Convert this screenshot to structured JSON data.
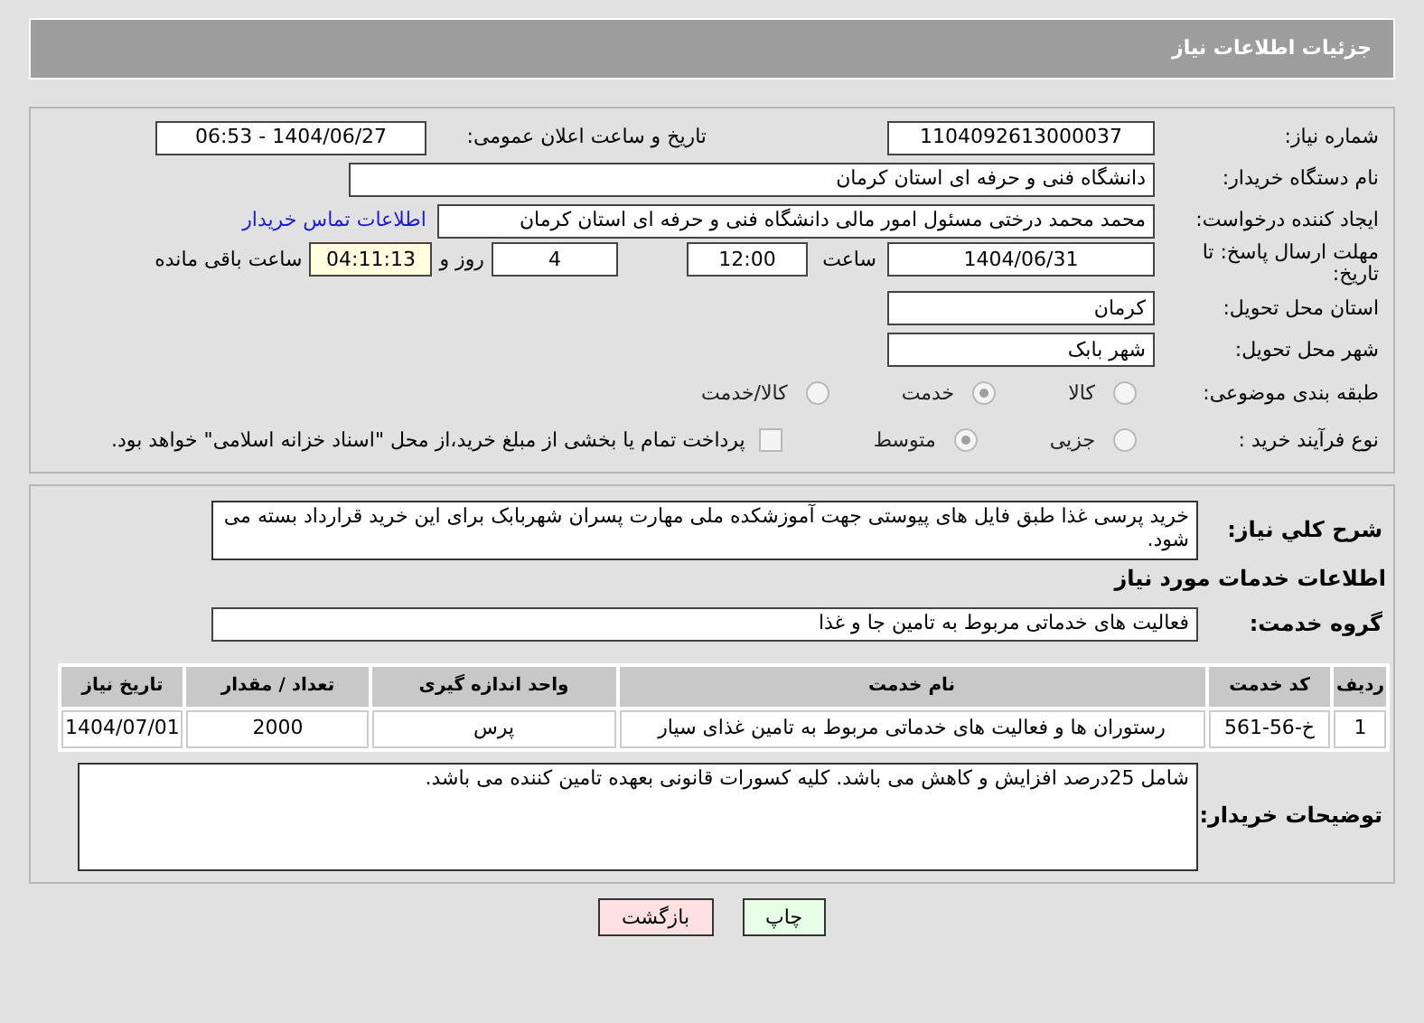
{
  "header": {
    "title": "جزئیات اطلاعات نیاز"
  },
  "details": {
    "need_number": {
      "label": "شماره نیاز:",
      "value": "1104092613000037"
    },
    "announce": {
      "label": "تاریخ و ساعت اعلان عمومی:",
      "value": "1404/06/27 - 06:53"
    },
    "buyer": {
      "label": "نام دستگاه خریدار:",
      "value": "دانشگاه فنی و حرفه ای استان کرمان"
    },
    "requester": {
      "label": "ایجاد کننده درخواست:",
      "value": "محمد محمد درختی مسئول امور مالی دانشگاه فنی و حرفه ای استان کرمان",
      "link": "اطلاعات تماس خریدار"
    },
    "deadline": {
      "label": "مهلت ارسال پاسخ: تا تاریخ:",
      "date": "1404/06/31",
      "time_label": "ساعت",
      "time": "12:00",
      "days": "4",
      "days_label": "روز و",
      "remaining": "04:11:13",
      "remaining_label": "ساعت باقی مانده"
    },
    "province": {
      "label": "استان محل تحویل:",
      "value": "کرمان"
    },
    "city": {
      "label": "شهر محل تحویل:",
      "value": "شهر بابک"
    },
    "category": {
      "label": "طبقه بندی موضوعی:",
      "options": [
        {
          "label": "کالا",
          "selected": false
        },
        {
          "label": "خدمت",
          "selected": true
        },
        {
          "label": "کالا/خدمت",
          "selected": false
        }
      ]
    },
    "process": {
      "label": "نوع فرآیند خرید :",
      "options": [
        {
          "label": "جزیی",
          "selected": false
        },
        {
          "label": "متوسط",
          "selected": true
        }
      ],
      "payment": {
        "checked": false,
        "text": "پرداخت تمام یا بخشی از مبلغ خرید،از محل \"اسناد خزانه اسلامی\" خواهد بود."
      }
    }
  },
  "services": {
    "description": {
      "label": "شرح کلي نياز:",
      "value": "خرید پرسی غذا طبق فایل های پیوستی جهت آموزشکده ملی مهارت پسران شهربابک برای این خرید قرارداد بسته می شود."
    },
    "heading": "اطلاعات خدمات مورد نیاز",
    "group": {
      "label": "گروه خدمت:",
      "value": "فعالیت های خدماتی مربوط به تامین جا و غذا"
    },
    "table": {
      "columns": [
        "ردیف",
        "کد خدمت",
        "نام خدمت",
        "واحد اندازه گیری",
        "تعداد / مقدار",
        "تاریخ نیاز"
      ],
      "rows": [
        [
          "1",
          "خ-56-561",
          "رستوران ها و فعالیت های خدماتی مربوط به تامین غذای سیار",
          "پرس",
          "2000",
          "1404/07/01"
        ]
      ]
    },
    "notes": {
      "label": "توضیحات خریدار:",
      "value": "شامل 25درصد افزایش و کاهش می باشد. کلیه کسورات قانونی بعهده تامین کننده می باشد."
    }
  },
  "buttons": [
    {
      "kind": "print",
      "label": "چاپ"
    },
    {
      "kind": "back",
      "label": "بازگشت"
    }
  ]
}
